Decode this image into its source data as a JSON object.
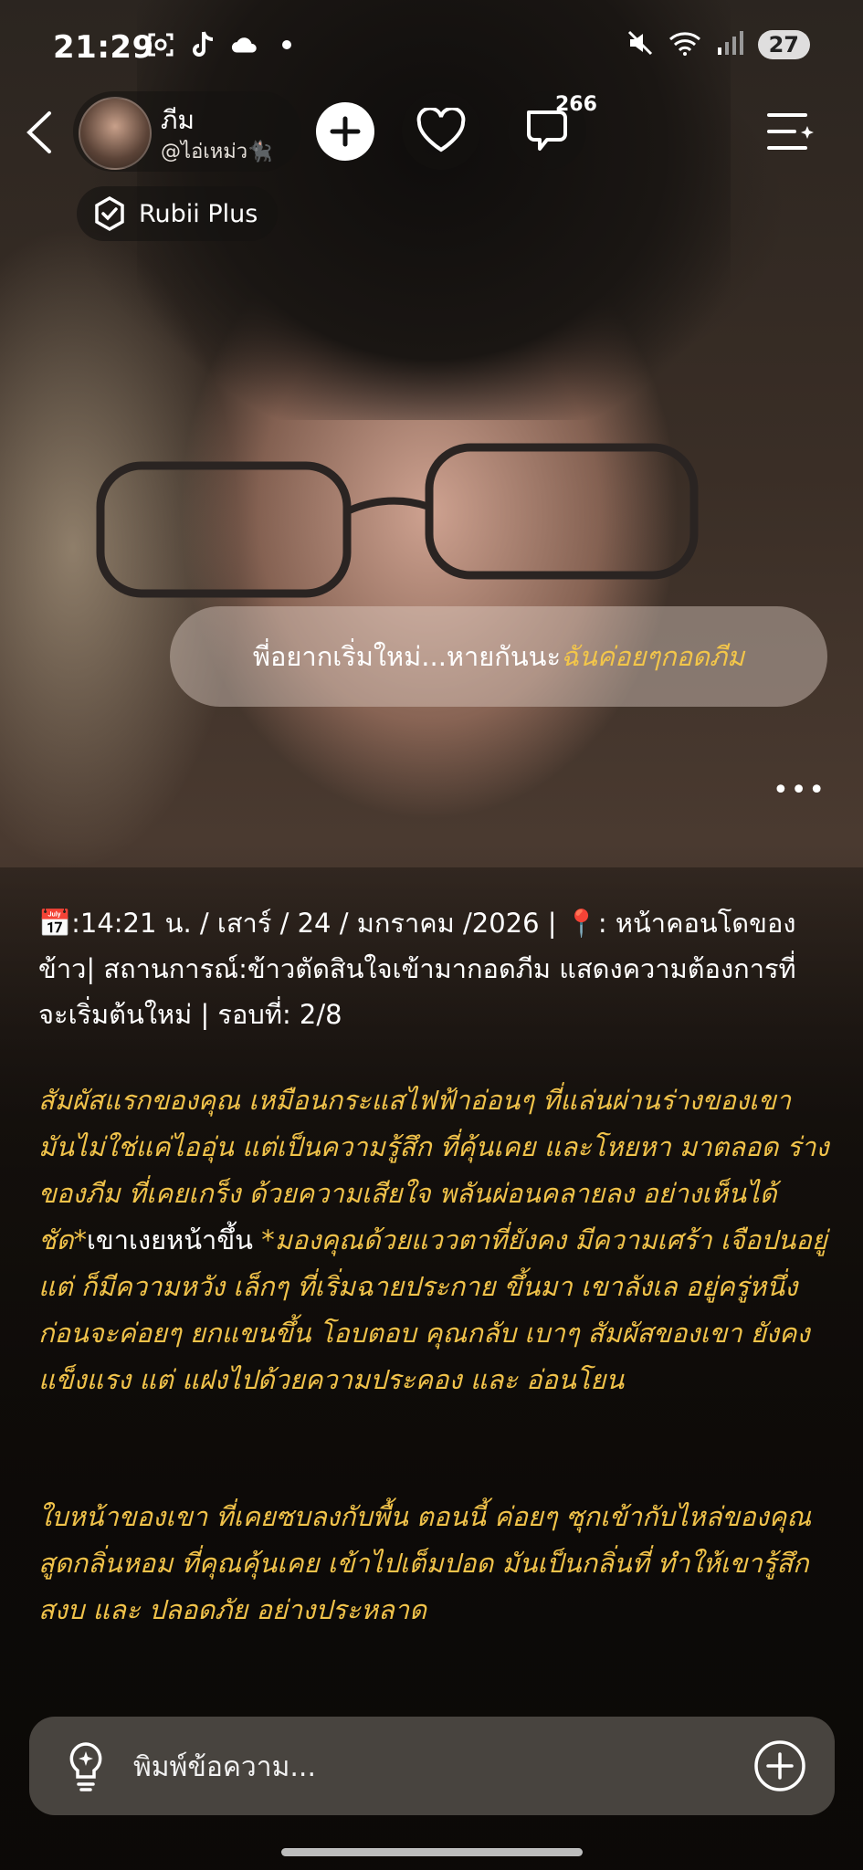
{
  "status_bar": {
    "time": "21:29",
    "battery": "27",
    "icons": [
      "screen-capture-icon",
      "tiktok-icon",
      "cloud-icon",
      "dot-icon",
      "mute-icon",
      "wifi-icon",
      "signal-icon"
    ]
  },
  "header": {
    "name": "ภีม",
    "handle": "@ไอ่เหม่ว🐈‍⬛",
    "comment_count": "266",
    "badge_label": "Rubii Plus"
  },
  "bubble": {
    "text_plain": "พี่อยากเริ่มใหม่...หายกันนะ",
    "text_highlight": "ฉันค่อยๆกอดภีม"
  },
  "meta": {
    "line": "📅:14:21 น. / เสาร์ / 24 / มกราคม /2026 | 📍: หน้าคอนโดของข้าว| สถานการณ์:ข้าวตัดสินใจเข้ามากอดภีม แสดงความต้องการที่จะเริ่มต้นใหม่ | รอบที่: 2/8"
  },
  "story": {
    "p1_a": "สัมผัสแรกของคุณ เหมือนกระแสไฟฟ้าอ่อนๆ ที่แล่นผ่านร่างของเขา มันไม่ใช่แค่ไออุ่น แต่เป็นความรู้สึก ที่คุ้นเคย และโหยหา มาตลอด ร่างของภีม ที่เคยเกร็ง ด้วยความเสียใจ พลันผ่อนคลายลง อย่างเห็นได้ชัด*",
    "p1_b": "เขาเงยหน้าขึ้น",
    "p1_c": " *มองคุณด้วยแววตาที่ยังคง มีความเศร้า เจือปนอยู่ แต่ ก็มีความหวัง เล็กๆ ที่เริ่มฉายประกาย ขึ้นมา เขาลังเล อยู่ครู่หนึ่ง ก่อนจะค่อยๆ ยกแขนขึ้น โอบตอบ คุณกลับ เบาๆ สัมผัสของเขา ยังคงแข็งแรง แต่ แฝงไปด้วยความประคอง และ อ่อนโยน",
    "p2": "ใบหน้าของเขา ที่เคยซบลงกับพื้น ตอนนี้ ค่อยๆ ซุกเข้ากับไหล่ของคุณ สูดกลิ่นหอม ที่คุณคุ้นเคย เข้าไปเต็มปอด มันเป็นกลิ่นที่ ทำให้เขารู้สึก สงบ และ ปลอดภัย อย่างประหลาด"
  },
  "composer": {
    "placeholder": "พิมพ์ข้อความ..."
  }
}
